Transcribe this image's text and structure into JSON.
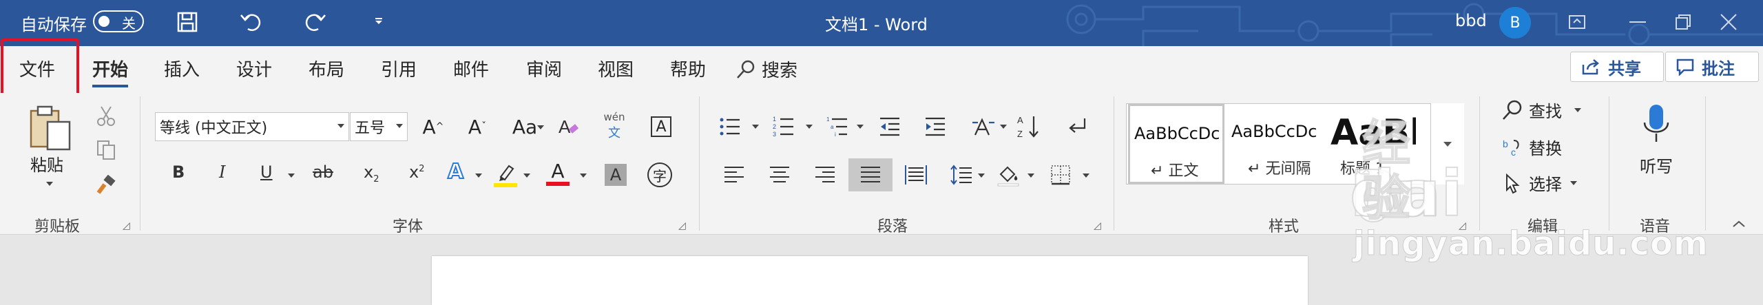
{
  "titlebar": {
    "autosave_label": "自动保存",
    "autosave_state": "关",
    "document_title": "文档1  -  Word",
    "user_name": "bbd",
    "avatar_initial": "B",
    "bg_color": "#2b579a"
  },
  "tabs": {
    "items": [
      "文件",
      "开始",
      "插入",
      "设计",
      "布局",
      "引用",
      "邮件",
      "审阅",
      "视图",
      "帮助"
    ],
    "active": "开始",
    "search_label": "搜索",
    "share_label": "共享",
    "comments_label": "批注",
    "highlight_color": "#e81123"
  },
  "clipboard": {
    "paste_label": "粘贴",
    "group_label": "剪贴板"
  },
  "font": {
    "font_name": "等线 (中文正文)",
    "font_size": "五号",
    "phonetic_top": "wén",
    "phonetic_bottom": "文",
    "group_label": "字体",
    "bold": "B",
    "italic": "I",
    "underline": "U",
    "strike": "ab",
    "subscript": "x",
    "superscript": "x",
    "change_case": "Aa",
    "grow": "A",
    "shrink": "A",
    "text_effect": "A",
    "font_color": "A",
    "char_shading": "A",
    "enclose": "字",
    "char_border": "A"
  },
  "paragraph": {
    "group_label": "段落"
  },
  "styles": {
    "group_label": "样式",
    "items": [
      {
        "sample": "AaBbCcDc",
        "name": "正文"
      },
      {
        "sample": "AaBbCcDc",
        "name": "无间隔"
      },
      {
        "sample": "AaBl",
        "name": "标题 1"
      }
    ]
  },
  "editing": {
    "find_label": "查找",
    "replace_label": "替换",
    "select_label": "选择",
    "group_label": "编辑"
  },
  "voice": {
    "dictate_label": "听写",
    "group_label": "语音"
  },
  "watermark": {
    "logo_text": "Bai",
    "logo_text_2": "du",
    "logo_cn": "经验",
    "url": "jingyan.baidu.com"
  }
}
